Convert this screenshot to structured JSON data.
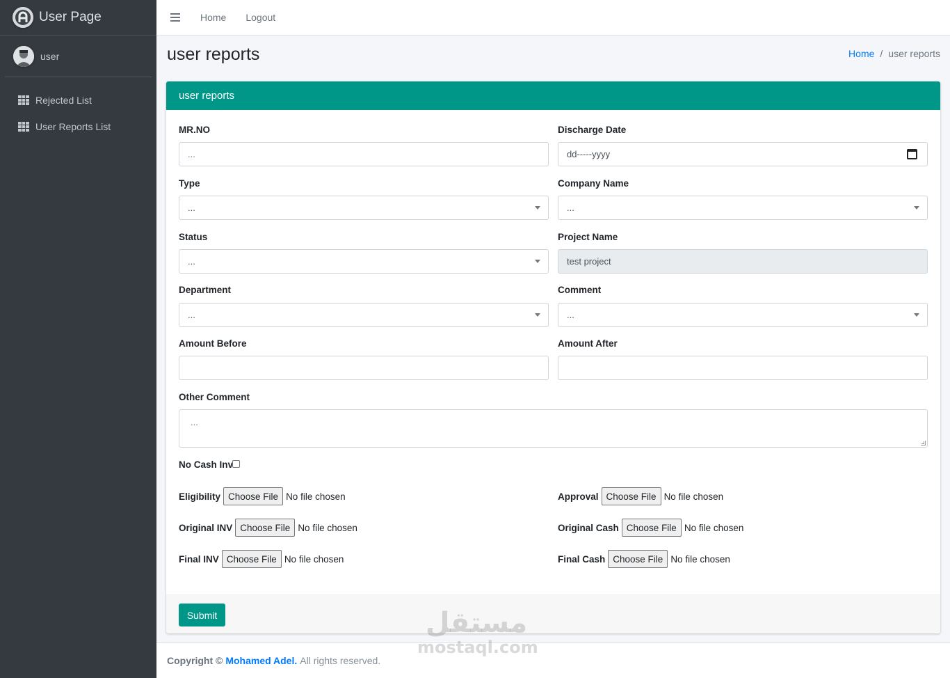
{
  "brand": {
    "title": "User Page"
  },
  "user": {
    "name": "user"
  },
  "sidebar": {
    "items": [
      {
        "label": "Rejected List",
        "icon": "grid-icon"
      },
      {
        "label": "User Reports List",
        "icon": "grid-icon"
      }
    ]
  },
  "topbar": {
    "home": "Home",
    "logout": "Logout"
  },
  "page": {
    "title": "user reports"
  },
  "breadcrumb": {
    "home": "Home",
    "separator": "/",
    "current": "user reports"
  },
  "card": {
    "title": "user reports"
  },
  "form": {
    "mrno": {
      "label": "MR.NO",
      "placeholder": "..."
    },
    "discharge_date": {
      "label": "Discharge Date",
      "placeholder": "dd-----yyyy"
    },
    "type": {
      "label": "Type",
      "value": "..."
    },
    "company_name": {
      "label": "Company Name",
      "value": "..."
    },
    "status": {
      "label": "Status",
      "value": "..."
    },
    "project_name": {
      "label": "Project Name",
      "value": "test project"
    },
    "department": {
      "label": "Department",
      "value": "..."
    },
    "comment": {
      "label": "Comment",
      "value": "..."
    },
    "amount_before": {
      "label": "Amount Before",
      "value": ""
    },
    "amount_after": {
      "label": "Amount After",
      "value": ""
    },
    "other_comment": {
      "label": "Other Comment",
      "placeholder": "..."
    },
    "no_cash_inv": {
      "label": "No Cash Inv",
      "checked": false
    },
    "files": {
      "button_label": "Choose File",
      "status_text": "No file chosen",
      "eligibility": "Eligibility",
      "approval": "Approval",
      "original_inv": "Original INV",
      "original_cash": "Original Cash",
      "final_inv": "Final INV",
      "final_cash": "Final Cash"
    },
    "submit": "Submit"
  },
  "footer": {
    "copyright": "Copyright ©",
    "author": "Mohamed Adel.",
    "rights": "All rights reserved."
  },
  "watermark": {
    "arabic": "مستقل",
    "latin": "mostaql.com"
  },
  "colors": {
    "accent": "#009688",
    "sidebar": "#343a40",
    "link": "#007bff"
  }
}
